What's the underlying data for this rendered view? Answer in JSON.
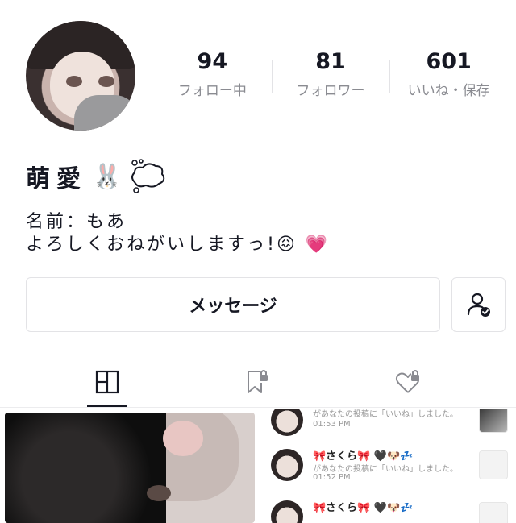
{
  "profile": {
    "name": "萌愛",
    "name_emoji": "🐰",
    "bio_line1": "名前：もあ",
    "bio_line2": "よろしくおねがいしますっ!😖 💗"
  },
  "stats": [
    {
      "value": "94",
      "label": "フォロー中"
    },
    {
      "value": "81",
      "label": "フォロワー"
    },
    {
      "value": "601",
      "label": "いいね・保存"
    }
  ],
  "actions": {
    "message_label": "メッセージ",
    "add_friend_icon": "user-check-icon"
  },
  "tabs": [
    {
      "icon": "grid-layout-icon",
      "active": true
    },
    {
      "icon": "bookmark-lock-icon",
      "active": false
    },
    {
      "icon": "heart-lock-icon",
      "active": false
    }
  ],
  "notifications": [
    {
      "name": "",
      "text": "があなたの投稿に「いいね」しました。",
      "time": "01:53 PM"
    },
    {
      "name": "🎀さくら🎀 🖤🐶💤",
      "text": "があなたの投稿に「いいね」しました。",
      "time": "01:52 PM"
    },
    {
      "name": "🎀さくら🎀 🖤🐶💤",
      "text": "",
      "time": ""
    }
  ],
  "colors": {
    "text": "#161823",
    "muted": "#8a8b91",
    "border": "#e3e3e6",
    "heart": "#ff5e8a"
  }
}
